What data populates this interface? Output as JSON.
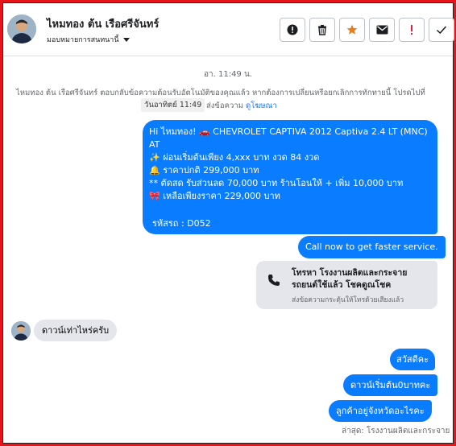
{
  "header": {
    "contact_name": "ไหมทอง ต้น เรือศรีจันทร์",
    "assign_label": "มอบหมายการสนทนานี้"
  },
  "actions": [
    {
      "icon": "alert-circle-icon"
    },
    {
      "icon": "trash-icon"
    },
    {
      "icon": "star-icon",
      "color": "#e67e22"
    },
    {
      "icon": "envelope-icon"
    },
    {
      "icon": "exclamation-icon",
      "color": "#e41e3f"
    },
    {
      "icon": "check-icon"
    }
  ],
  "chat": {
    "timestamp": "อา. 11:49 น.",
    "system_text": "ไหมทอง ต้น เรือศรีจันทร์ ตอบกลับข้อความต้อนรับอัตโนมัติของคุณแล้ว หากต้องการเปลี่ยนหรือยกเลิกการทักทายนี้ โปรดไปที่",
    "system_text2": "ส่งข้อความ",
    "system_link": "ดูโฆษณา",
    "tooltip": "วันอาทิตย์ 11:49",
    "ad_message": {
      "line1": "Hi ไหมทอง! 🚗  CHEVROLET CAPTIVA 2012 Captiva 2.4 LT (MNC)",
      "line2": "AT",
      "line3": "✨  ผ่อนเริ่มต้นเพียง 4,xxx บาท งวด 84 งวด",
      "line4": "🔔 ราคาปกติ 299,000 บาท",
      "line5": "** ตัดสด รับส่วนลด 70,000 บาท ร้านโอนให้ + เพิ่ม 10,000 บาท",
      "line6": "🎀  เหลือเพียงราคา 229,000 บาท",
      "sku": "รหัสรถ : D052"
    },
    "call_now": "Call now to get faster service.",
    "call_card": {
      "title1": "โทรหา โรงงานผลิตและกระจาย",
      "title2": "รถยนต์ใช้แล้ว โชคดูณโชค",
      "subtitle": "ส่งข้อความกระตุ้นให้โทรด้วยเสียงแล้ว"
    },
    "incoming_1": "ดาวน์เท่าไหร่ครับ",
    "outgoing_1": "สวัสดีคะ",
    "outgoing_2": "ดาวน์เริ่มต้น0บาทคะ",
    "outgoing_3": "ลูกค้าอยู่จังหวัดอะไรคะ",
    "partial": "ล่าสุด: โรงงานผลิตและกระจาย"
  },
  "colors": {
    "accent_blue": "#0a7cff",
    "link_blue": "#1877f2",
    "frame_red": "#e8141b"
  }
}
